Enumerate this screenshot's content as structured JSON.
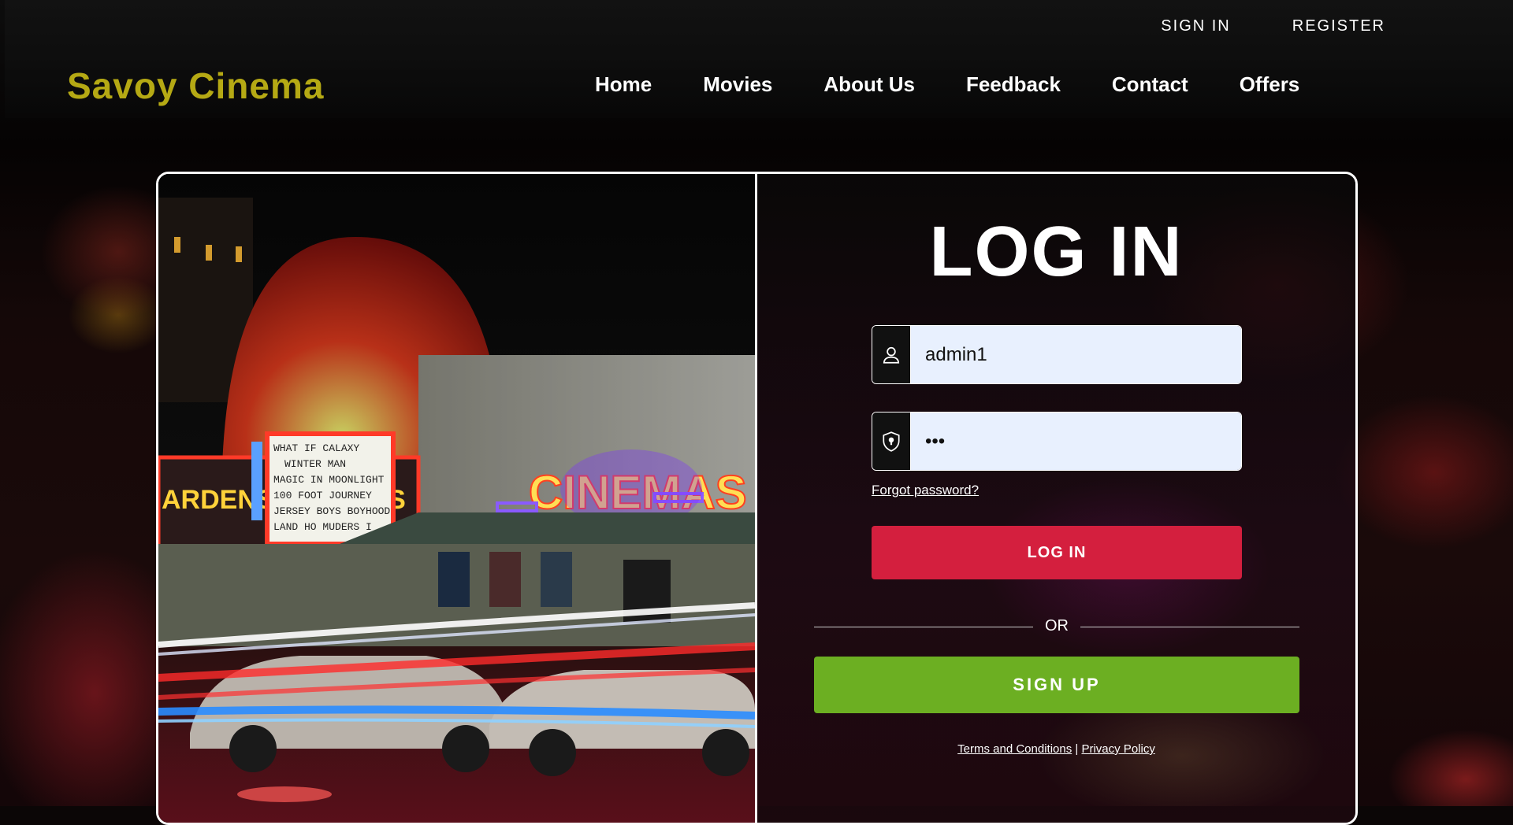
{
  "header": {
    "brand": "Savoy Cinema",
    "top_links": [
      "SIGN IN",
      "REGISTER"
    ],
    "nav": [
      "Home",
      "Movies",
      "About Us",
      "Feedback",
      "Contact",
      "Offers"
    ]
  },
  "photo": {
    "marquee_left": "ARDENS CINEMAS",
    "marquee_sign": "CINEMAS",
    "marquee_board": [
      "WHAT IF    CALAXY",
      "WINTER MAN",
      "MAGIC IN MOONLIGHT",
      "100 FOOT JOURNEY",
      "JERSEY BOYS BOYHOOD",
      "LAND HO  MUDERS I"
    ]
  },
  "login": {
    "title": "LOG IN",
    "username_value": "admin1",
    "password_value": "•••",
    "forgot_label": "Forgot password?",
    "login_button": "LOG IN",
    "or_label": "OR",
    "signup_button": "SIGN  UP",
    "terms_label": "Terms and Conditions",
    "separator": " | ",
    "privacy_label": "Privacy Policy"
  },
  "colors": {
    "brand": "#b5a914",
    "login_button": "#d41f3e",
    "signup_button": "#6caf22",
    "input_bg": "#e8f0fe"
  },
  "icons": {
    "username": "user-icon",
    "password": "shield-keyhole-icon"
  }
}
